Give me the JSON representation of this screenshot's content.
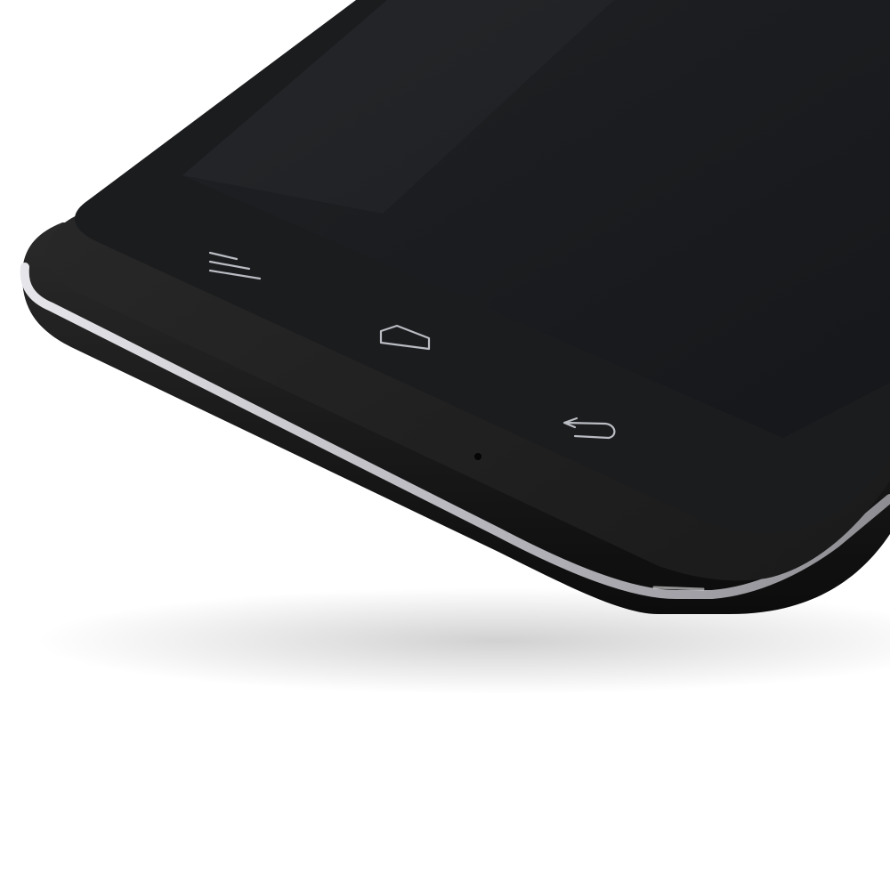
{
  "photo": {
    "subject": "smartphone",
    "colors": {
      "background": "#ffffff",
      "body": "#141414",
      "bezel": "#1f1f1f",
      "screen": "#191b1e",
      "trim": "#c9c9ce",
      "key_glyph": "#b9bcc2"
    }
  },
  "keys": [
    {
      "icon": "menu-icon"
    },
    {
      "icon": "home-icon"
    },
    {
      "icon": "back-icon"
    }
  ],
  "microphone": {
    "icon": "microphone-hole"
  }
}
